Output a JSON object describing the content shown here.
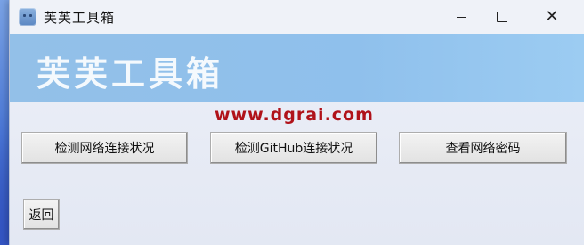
{
  "window": {
    "title": "芙芙工具箱",
    "minimize_icon": "minimize-icon",
    "maximize_icon": "maximize-icon",
    "close_glyph": "✕"
  },
  "banner": {
    "title": "芙芙工具箱"
  },
  "watermark": {
    "text": "www.dgrai.com",
    "color": "#b0121a"
  },
  "actions": {
    "check_network": "检测网络连接状况",
    "check_github": "检测GitHub连接状况",
    "view_wifi_password": "查看网络密码"
  },
  "footer": {
    "back": "返回"
  },
  "colors": {
    "banner": "#93c0e8",
    "window_bg": "#eef1f8"
  }
}
